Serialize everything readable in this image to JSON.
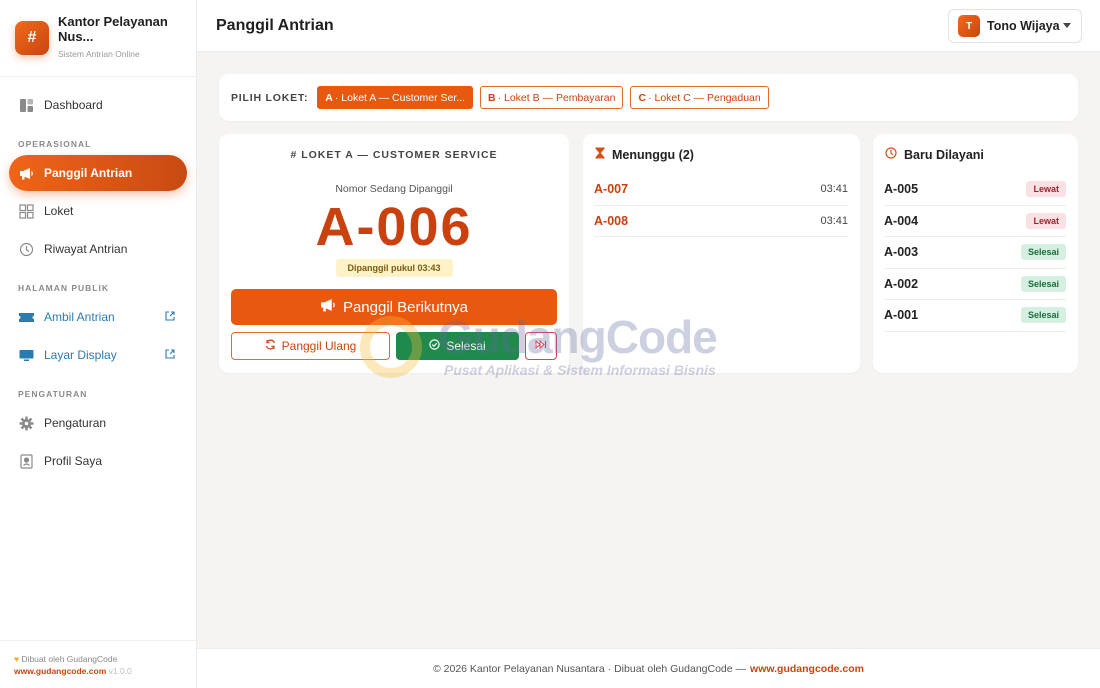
{
  "brand": {
    "title": "Kantor Pelayanan Nus...",
    "subtitle": "Sistem Antrian Online",
    "logo_glyph": "#"
  },
  "sidebar": {
    "dashboard": "Dashboard",
    "section_operasional": "OPERASIONAL",
    "panggil": "Panggil Antrian",
    "loket": "Loket",
    "riwayat": "Riwayat Antrian",
    "section_publik": "HALAMAN PUBLIK",
    "ambil": "Ambil Antrian",
    "layar": "Layar Display",
    "section_pengaturan": "PENGATURAN",
    "pengaturan": "Pengaturan",
    "profil": "Profil Saya",
    "footer_made": "Dibuat oleh GudangCode",
    "footer_url": "www.gudangcode.com",
    "footer_version": "v1.0.0"
  },
  "header": {
    "title": "Panggil Antrian",
    "user_initial": "T",
    "user_name": "Tono Wijaya"
  },
  "picker": {
    "label": "PILIH LOKET:",
    "chips": [
      {
        "code": "A",
        "label": "· Loket A — Customer Ser..."
      },
      {
        "code": "B",
        "label": "· Loket B — Pembayaran"
      },
      {
        "code": "C",
        "label": "· Loket C — Pengaduan"
      }
    ]
  },
  "main": {
    "heading": "# LOKET A — CUSTOMER SERVICE",
    "sub": "Nomor Sedang Dipanggil",
    "current": "A-006",
    "called_at": "Dipanggil pukul 03:43",
    "btn_next": "Panggil Berikutnya",
    "btn_recall": "Panggil Ulang",
    "btn_done": "Selesai"
  },
  "waiting": {
    "title": "Menunggu (2)",
    "items": [
      {
        "code": "A-007",
        "time": "03:41"
      },
      {
        "code": "A-008",
        "time": "03:41"
      }
    ]
  },
  "served": {
    "title": "Baru Dilayani",
    "items": [
      {
        "code": "A-005",
        "status": "Lewat"
      },
      {
        "code": "A-004",
        "status": "Lewat"
      },
      {
        "code": "A-003",
        "status": "Selesai"
      },
      {
        "code": "A-002",
        "status": "Selesai"
      },
      {
        "code": "A-001",
        "status": "Selesai"
      }
    ]
  },
  "footer": {
    "text": "© 2026 Kantor Pelayanan Nusantara · Dibuat oleh GudangCode —",
    "url": "www.gudangcode.com"
  },
  "watermark": {
    "title": "GudangCode",
    "subtitle": "Pusat Aplikasi & Sistem Informasi Bisnis"
  },
  "colors": {
    "accent": "#e8580f",
    "accent_dark": "#c8410f",
    "success": "#1f8a4c",
    "danger": "#d9415a",
    "link": "#2a7bb0"
  }
}
